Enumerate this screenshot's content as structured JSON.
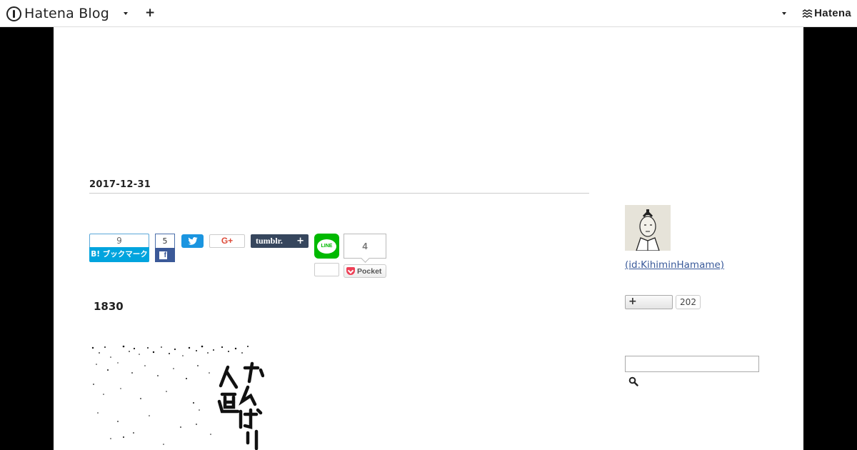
{
  "header": {
    "brand": "Hatena Blog",
    "add_label": "+",
    "right_brand": "Hatena"
  },
  "entry": {
    "date": "2017-12-31",
    "number": "1830",
    "image_text": "がんばり入道"
  },
  "share": {
    "hatena_count": "9",
    "hatena_label": "B! ブックマーク",
    "facebook_count": "5",
    "gplus_label": "G+",
    "tumblr_label": "tumblr.",
    "line_label": "LINE",
    "pocket_count": "4",
    "pocket_label": "Pocket"
  },
  "sidebar": {
    "profile_link": " (id:KihiminHamame)",
    "follow_label": "+",
    "follow_count": "202",
    "search_placeholder": ""
  },
  "colors": {
    "hatena_blue": "#00a4de",
    "facebook": "#3b5998",
    "twitter": "#1b95e0",
    "tumblr": "#36465d",
    "line": "#00b900",
    "pocket": "#ee4056",
    "link": "#3a5a9a"
  }
}
